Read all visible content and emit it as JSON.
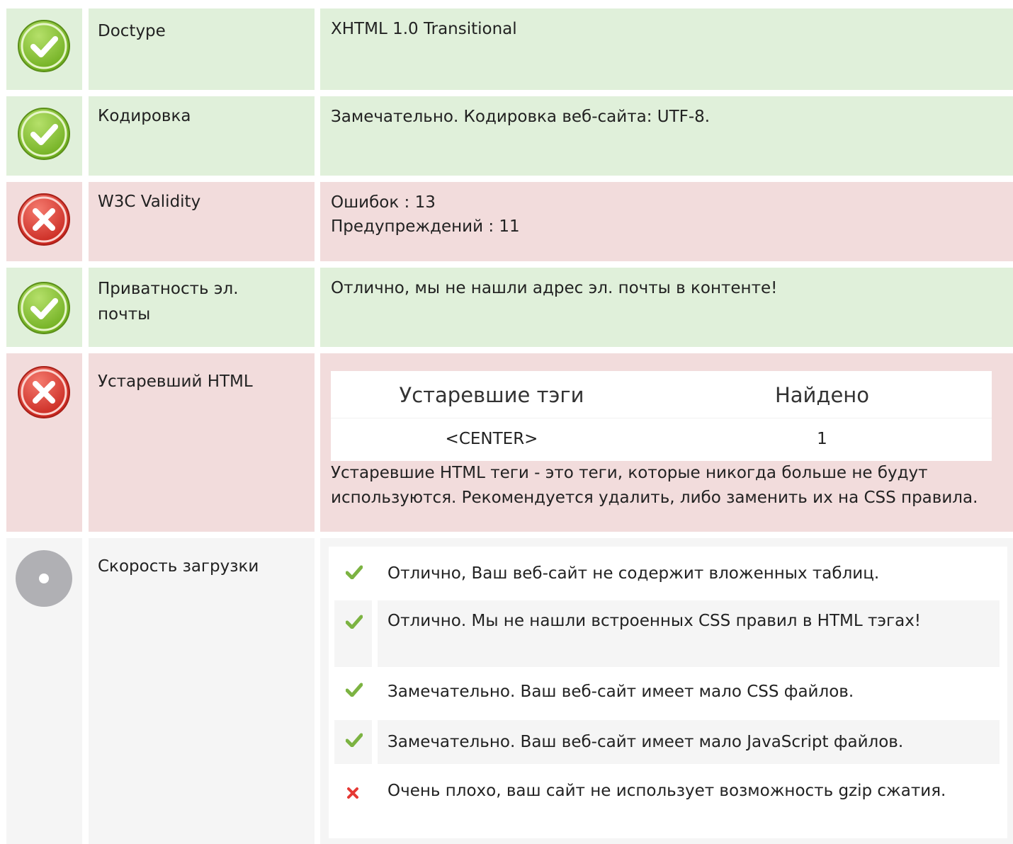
{
  "rows": [
    {
      "status": "ok",
      "label": "Doctype",
      "value": "XHTML 1.0 Transitional"
    },
    {
      "status": "ok",
      "label": "Кодировка",
      "value": "Замечательно. Кодировка веб-сайта: UTF-8."
    },
    {
      "status": "error",
      "label": "W3C Validity",
      "value_line1": "Ошибок : 13",
      "value_line2": "Предупреждений : 11"
    },
    {
      "status": "ok",
      "label": "Приватность эл. почты",
      "value": "Отлично, мы не нашли адрес эл. почты в контенте!"
    },
    {
      "status": "error",
      "label": "Устаревший HTML",
      "deprecated_table": {
        "headers": [
          "Устаревшие тэги",
          "Найдено"
        ],
        "rows": [
          {
            "tag": "<CENTER>",
            "count": "1"
          }
        ]
      },
      "note": "Устаревшие HTML теги - это теги, которые никогда больше не будут используются. Рекомендуется удалить, либо заменить их на CSS правила."
    },
    {
      "status": "neutral",
      "label": "Скорость загрузки",
      "items": [
        {
          "ok": true,
          "text": "Отлично, Ваш веб-сайт не содержит вложенных таблиц."
        },
        {
          "ok": true,
          "text": "Отлично. Мы не нашли встроенных CSS правил в HTML тэгах!"
        },
        {
          "ok": true,
          "text": "Замечательно. Ваш веб-сайт имеет мало CSS файлов."
        },
        {
          "ok": true,
          "text": "Замечательно. Ваш веб-сайт имеет мало JavaScript файлов."
        },
        {
          "ok": false,
          "text": "Очень плохо, ваш сайт не использует возможность gzip сжатия."
        }
      ]
    }
  ],
  "icons": {
    "ok": "check-circle-icon",
    "error": "x-circle-icon",
    "neutral": "neutral-circle-icon",
    "item_ok": "checkmark-icon",
    "item_bad": "x-mark-icon"
  },
  "colors": {
    "ok_bg": "#e0f0da",
    "error_bg": "#f2dcdc",
    "neutral_bg": "#f5f5f5",
    "ok_icon": "#8cc63f",
    "error_icon": "#e2453c",
    "neutral_icon": "#b0b0b4"
  }
}
